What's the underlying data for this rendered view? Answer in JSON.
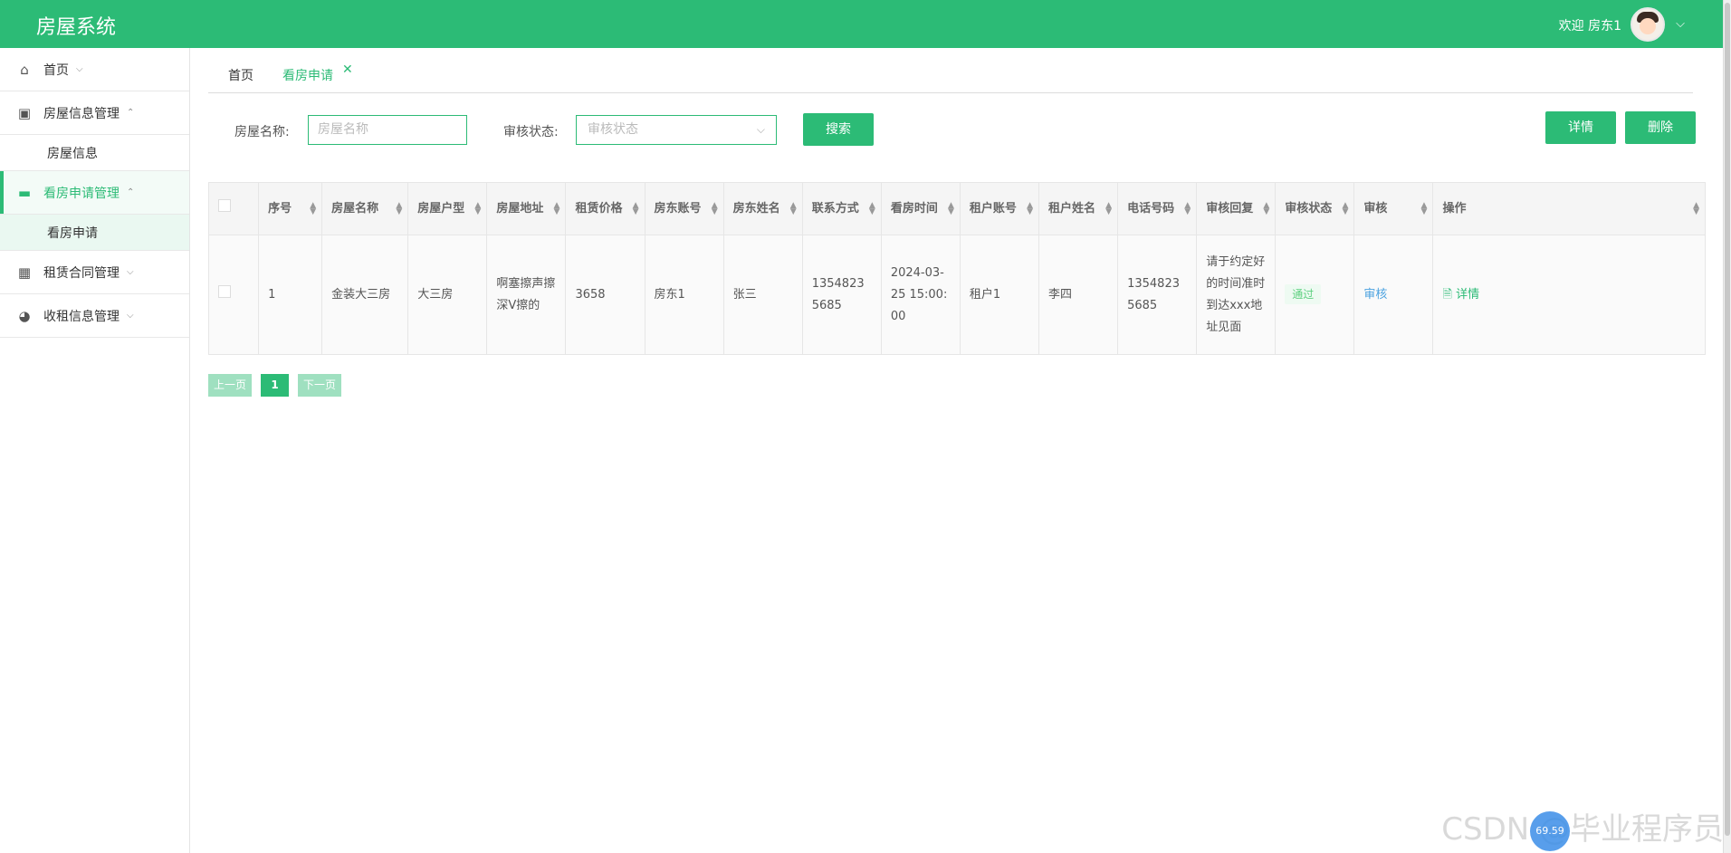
{
  "app": {
    "title": "房屋系统",
    "welcome": "欢迎 房东1"
  },
  "sidebar": {
    "items": [
      {
        "label": "首页",
        "icon": "home-icon"
      },
      {
        "label": "房屋信息管理",
        "icon": "gift-icon"
      },
      {
        "label": "房屋信息"
      },
      {
        "label": "看房申请管理",
        "icon": "list-icon"
      },
      {
        "label": "看房申请"
      },
      {
        "label": "租赁合同管理",
        "icon": "grid-icon"
      },
      {
        "label": "收租信息管理",
        "icon": "gauge-icon"
      }
    ]
  },
  "tabs": {
    "home": "首页",
    "current": "看房申请"
  },
  "filters": {
    "house_name_label": "房屋名称:",
    "house_name_placeholder": "房屋名称",
    "status_label": "审核状态:",
    "status_placeholder": "审核状态",
    "search": "搜索",
    "detail": "详情",
    "delete": "删除"
  },
  "table": {
    "headers": [
      "序号",
      "房屋名称",
      "房屋户型",
      "房屋地址",
      "租赁价格",
      "房东账号",
      "房东姓名",
      "联系方式",
      "看房时间",
      "租户账号",
      "租户姓名",
      "电话号码",
      "审核回复",
      "审核状态",
      "审核",
      "操作"
    ],
    "rows": [
      {
        "seq": "1",
        "house_name": "金装大三房",
        "layout": "大三房",
        "address": "啊塞擦声擦深V擦的",
        "price": "3658",
        "landlord_account": "房东1",
        "landlord_name": "张三",
        "contact": "13548235685",
        "view_time": "2024-03-25 15:00:00",
        "tenant_account": "租户1",
        "tenant_name": "李四",
        "phone": "13548235685",
        "reply": "请于约定好的时间准时到达xxx地址见面",
        "status": "通过",
        "audit": "审核",
        "op": "详情"
      }
    ]
  },
  "pager": {
    "prev": "上一页",
    "page": "1",
    "next": "下一页"
  },
  "watermark": "CSDN @毕业程序员",
  "float_ball": "69.59"
}
